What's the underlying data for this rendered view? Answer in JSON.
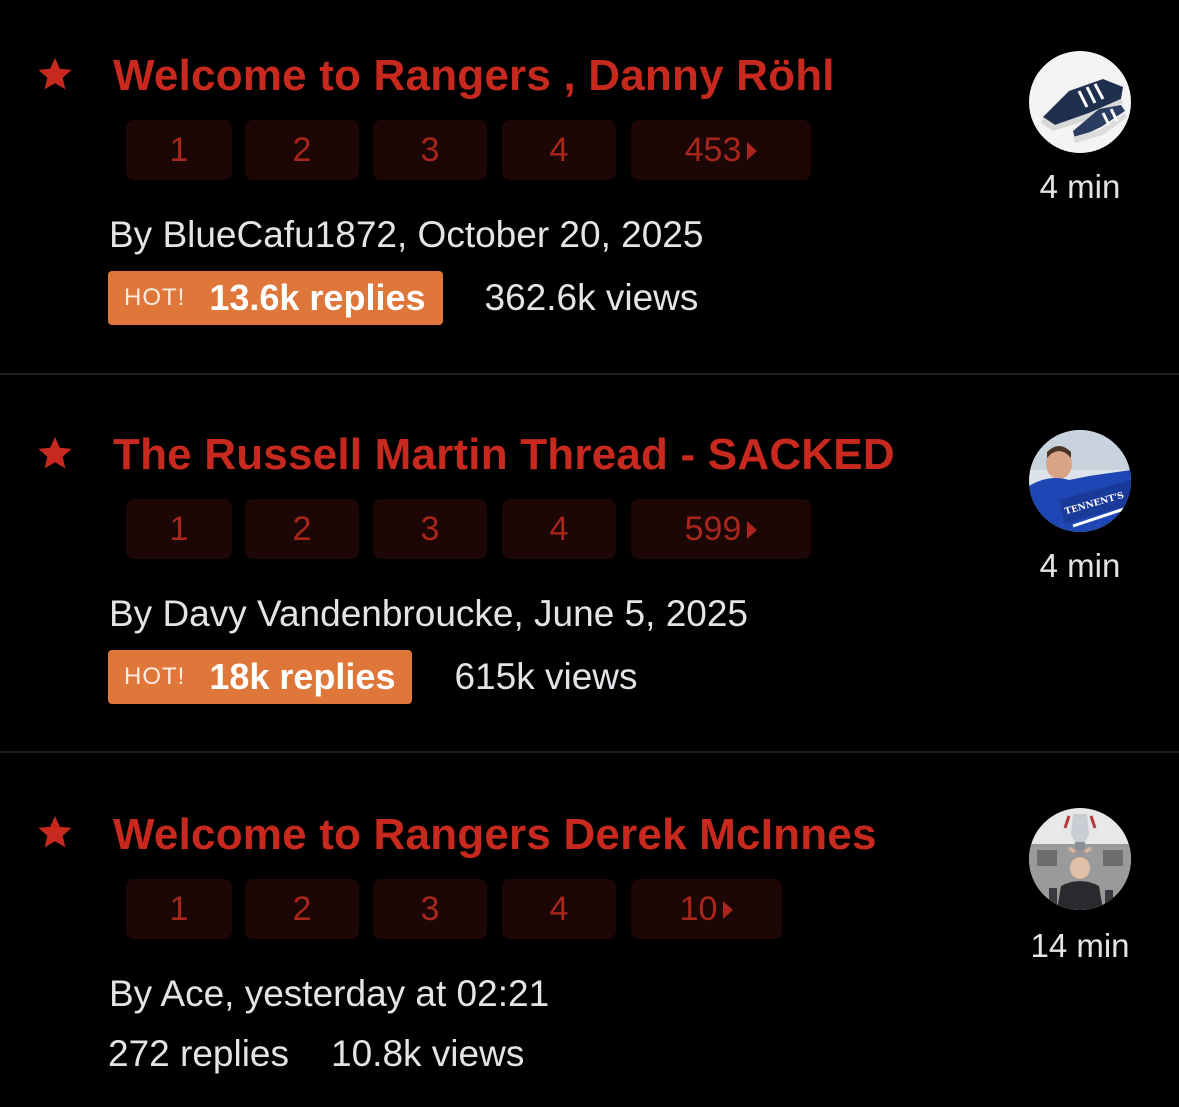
{
  "topics": [
    {
      "title": "Welcome to Rangers , Danny Röhl",
      "pages": [
        "1",
        "2",
        "3",
        "4",
        "453"
      ],
      "byline": "By BlueCafu1872, October 20, 2025",
      "hot": true,
      "hot_label": "HOT!",
      "replies": "13.6k replies",
      "views": "362.6k views",
      "last_activity": "4 min",
      "avatar_icon": "sneakers-avatar"
    },
    {
      "title": "The Russell Martin Thread - SACKED",
      "pages": [
        "1",
        "2",
        "3",
        "4",
        "599"
      ],
      "byline": "By Davy Vandenbroucke, June 5, 2025",
      "hot": true,
      "hot_label": "HOT!",
      "replies": "18k replies",
      "views": "615k views",
      "last_activity": "4 min",
      "avatar_icon": "rangers-shirt-avatar",
      "avatar_text": "TENNENT'S"
    },
    {
      "title": "Welcome to Rangers Derek McInnes",
      "pages": [
        "1",
        "2",
        "3",
        "4",
        "10"
      ],
      "byline": "By Ace, yesterday at 02:21",
      "hot": false,
      "replies": "272 replies",
      "views": "10.8k views",
      "last_activity": "14 min",
      "avatar_icon": "trophy-avatar"
    }
  ],
  "colors": {
    "background": "#000000",
    "title_red": "#c8291e",
    "page_button_bg": "#1c0606",
    "page_button_text": "#a8261b",
    "hot_badge": "#e0773a",
    "divider": "#1f1f22",
    "text": "#e3e3e8"
  },
  "icons": {
    "star": "star-icon",
    "next_page": "caret-right-icon"
  }
}
